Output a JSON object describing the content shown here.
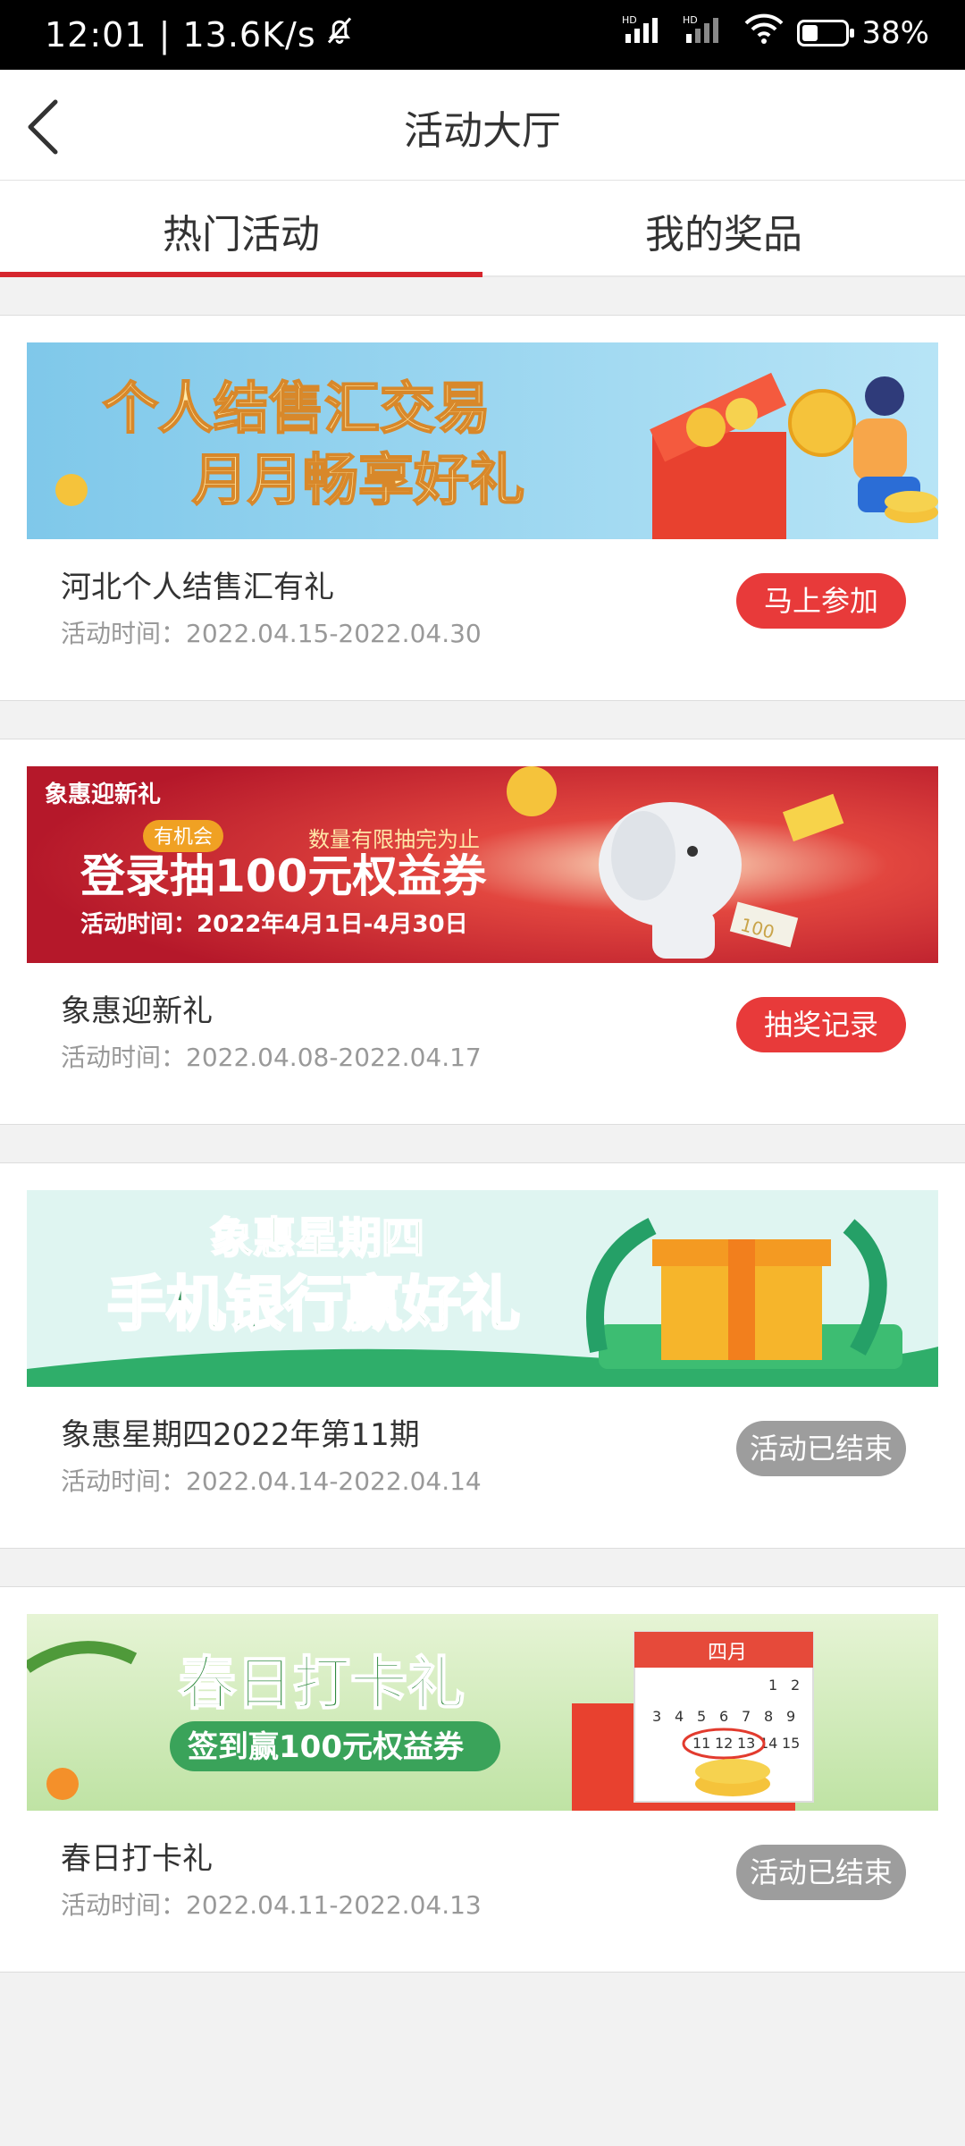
{
  "status_bar": {
    "time": "12:01",
    "speed": "13.6K/s",
    "mute_icon": "bell-off-icon",
    "signal_label_1": "HD",
    "signal_label_2": "HD",
    "battery": "38%",
    "battery_level": 0.38
  },
  "header": {
    "title": "活动大厅",
    "back_icon": "chevron-left-icon"
  },
  "tabs": [
    {
      "label": "热门活动",
      "active": true
    },
    {
      "label": "我的奖品",
      "active": false
    }
  ],
  "activities": [
    {
      "banner": {
        "line1": "个人结售汇交易",
        "line2": "月月畅享好礼"
      },
      "title": "河北个人结售汇有礼",
      "time": "活动时间：2022.04.15-2022.04.30",
      "button": "马上参加",
      "button_state": "active"
    },
    {
      "banner": {
        "tag": "有机会",
        "note": "数量有限抽完为止",
        "logo": "象惠迎新礼",
        "headline": "登录抽100元权益券",
        "date": "活动时间：2022年4月1日-4月30日",
        "ticket": "100"
      },
      "title": "象惠迎新礼",
      "time": "活动时间：2022.04.08-2022.04.17",
      "button": "抽奖记录",
      "button_state": "active"
    },
    {
      "banner": {
        "line1": "象惠星期四",
        "line2": "手机银行赢好礼"
      },
      "title": "象惠星期四2022年第11期",
      "time": "活动时间：2022.04.14-2022.04.14",
      "button": "活动已结束",
      "button_state": "ended"
    },
    {
      "banner": {
        "line1": "春日打卡礼",
        "line2": "签到赢100元权益券",
        "month": "四月"
      },
      "title": "春日打卡礼",
      "time": "活动时间：2022.04.11-2022.04.13",
      "button": "活动已结束",
      "button_state": "ended"
    }
  ],
  "colors": {
    "accent": "#d6262e",
    "button_active": "#e83a3a",
    "button_ended": "#9d9d9d"
  }
}
